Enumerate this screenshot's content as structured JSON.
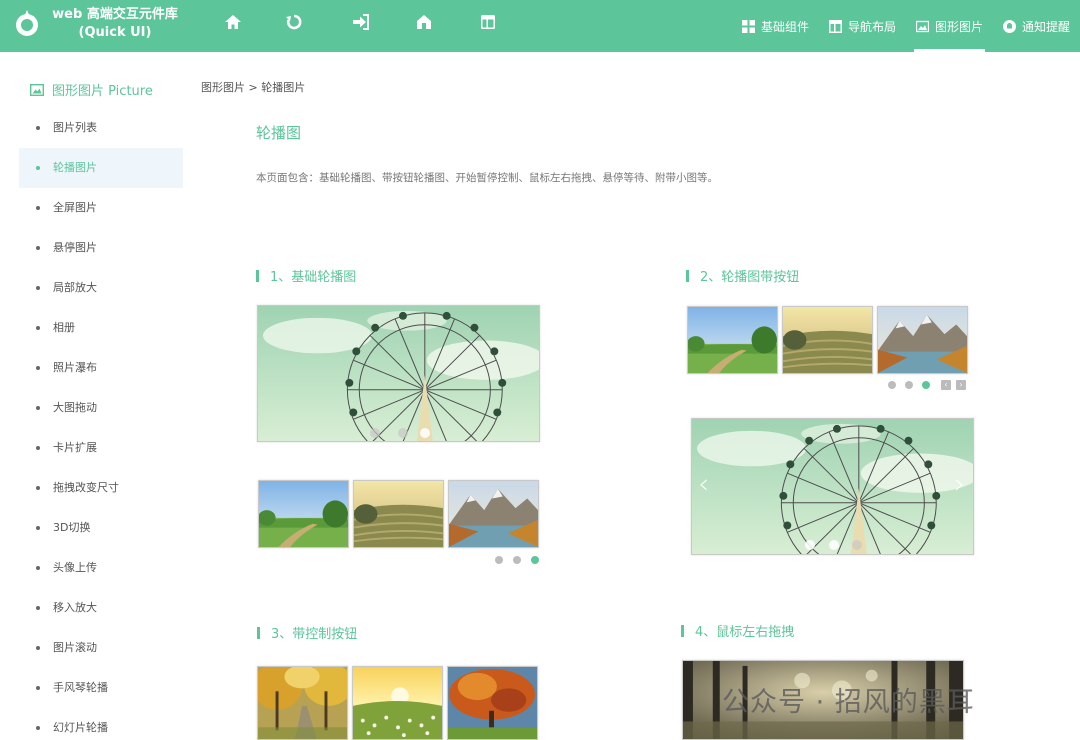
{
  "header": {
    "brand_line1": "web 高端交互元件库",
    "brand_line2": "(Quick UI)",
    "toolbar_icons": [
      "home-icon",
      "refresh-icon",
      "login-icon",
      "house-icon",
      "layout-icon"
    ],
    "nav": [
      {
        "label": "基础组件",
        "icon": "grid-icon"
      },
      {
        "label": "导航布局",
        "icon": "layout-icon"
      },
      {
        "label": "图形图片",
        "icon": "image-icon",
        "active": true
      },
      {
        "label": "通知提醒",
        "icon": "bell-icon"
      }
    ]
  },
  "sidebar": {
    "title": "图形图片 Picture",
    "items": [
      "图片列表",
      "轮播图片",
      "全屏图片",
      "悬停图片",
      "局部放大",
      "相册",
      "照片瀑布",
      "大图拖动",
      "卡片扩展",
      "拖拽改变尺寸",
      "3D切换",
      "头像上传",
      "移入放大",
      "图片滚动",
      "手风琴轮播",
      "幻灯片轮播"
    ],
    "active_index": 1
  },
  "main": {
    "breadcrumb": "图形图片 > 轮播图片",
    "title": "轮播图",
    "description": "本页面包含：基础轮播图、带按钮轮播图、开始暂停控制、鼠标左右拖拽、悬停等待、附带小图等。",
    "sections": [
      {
        "title": "1、基础轮播图"
      },
      {
        "title": "2、轮播图带按钮"
      },
      {
        "title": "3、带控制按钮"
      },
      {
        "title": "4、鼠标左右拖拽"
      }
    ],
    "button_prev": "‹",
    "button_next": "›"
  },
  "watermark": "公众号 · 招风的黑耳",
  "colors": {
    "accent": "#5cc59a",
    "active_bg": "#eef5fb"
  }
}
